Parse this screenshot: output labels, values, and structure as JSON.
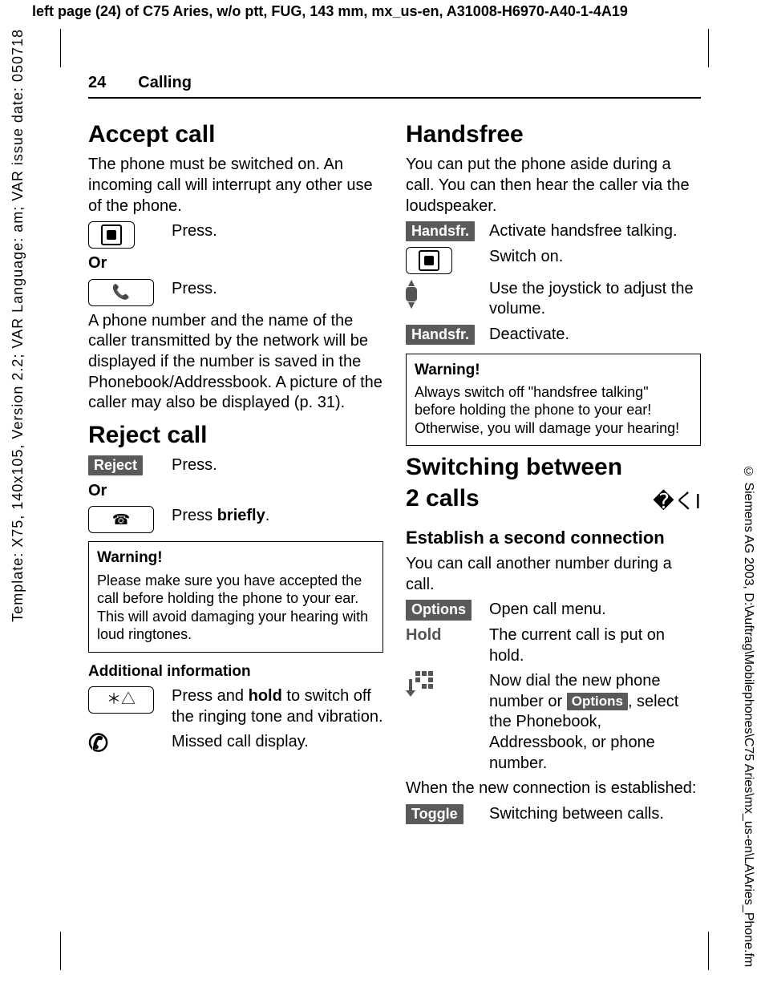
{
  "meta": {
    "top_header": "left page (24) of C75 Aries, w/o ptt, FUG, 143 mm, mx_us-en, A31008-H6970-A40-1-4A19",
    "left_margin": "Template: X75, 140x105, Version 2.2; VAR Language: am; VAR issue date: 050718",
    "right_margin": "© Siemens AG 2003, D:\\Auftrag\\Mobilephones\\C75 Aries\\mx_us-en\\LA\\Aries_Phone.fm",
    "page_number": "24",
    "section": "Calling"
  },
  "left": {
    "accept": {
      "title": "Accept call",
      "intro": "The phone must be switched on. An incoming call will interrupt any other use of the phone.",
      "press": "Press.",
      "or": "Or",
      "after": "A phone number and the name of the caller transmitted by the network will be displayed if the number is saved in the Phonebook/Addressbook. A picture of the caller may also be displayed (p. 31)."
    },
    "reject": {
      "title": "Reject call",
      "reject_label": "Reject",
      "press": "Press.",
      "or": "Or",
      "briefly_pre": "Press ",
      "briefly_bold": "briefly",
      "briefly_post": "."
    },
    "warning": {
      "title": "Warning!",
      "body": "Please make sure you have accepted the call before holding the phone to your ear. This will avoid damaging your hearing with loud ringtones."
    },
    "additional": {
      "title": "Additional information",
      "hold_pre": "Press and ",
      "hold_bold": "hold",
      "hold_post": " to switch off the ringing tone and vibration.",
      "missed": "Missed call display."
    }
  },
  "right": {
    "handsfree": {
      "title": "Handsfree",
      "intro": "You can put the phone aside during a call. You can then hear the caller via the loudspeaker.",
      "label": "Handsfr.",
      "activate": "Activate handsfree talking.",
      "switchon": "Switch on.",
      "joy": "Use the joystick to adjust the volume.",
      "deactivate": "Deactivate."
    },
    "warning": {
      "title": "Warning!",
      "body": "Always switch off \"handsfree talking\" before holding the phone to your ear! Otherwise, you will damage your hearing!"
    },
    "switch": {
      "title_l1": "Switching between",
      "title_l2": "2 calls",
      "subtitle": "Establish a second connection",
      "intro": "You can call another number during a call.",
      "options_label": "Options",
      "open_menu": "Open call menu.",
      "hold_label": "Hold",
      "hold_desc": "The current call is put on hold.",
      "dial_pre": "Now dial the new phone number or ",
      "dial_post": ", select the Phonebook, Addressbook, or phone number.",
      "established": "When the new connection is established:",
      "toggle_label": "Toggle",
      "toggle_desc": "Switching between calls."
    }
  }
}
